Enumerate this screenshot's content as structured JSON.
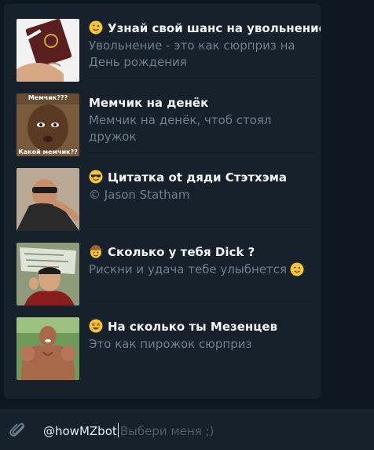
{
  "results": [
    {
      "title": "Узнай свой шанс на увольнение",
      "description": "Увольнение - это как сюрприз на День рождения",
      "emoji_icon": "winking-face-icon"
    },
    {
      "title": "Мемчик на денёк",
      "description": "Мемчик на денёк, чтоб стоял дружок",
      "thumb_caption_top": "Мемчик???",
      "thumb_caption_bottom": "Какой мемчик??"
    },
    {
      "title": "Цитатка ot дяди Стэтхэма",
      "description": "© Jason Statham",
      "emoji_icon": "sunglasses-face-icon"
    },
    {
      "title": "Сколько у тебя Dick ?",
      "description": "Рискни и удача тебе улыбнется",
      "emoji_icon": "cowboy-face-icon",
      "description_emoji_icon": "winking-face-icon"
    },
    {
      "title": "На сколько ты Мезенцев",
      "description": "Это как пирожок сюрприз",
      "emoji_icon": "star-struck-face-icon"
    }
  ],
  "composer": {
    "bot_username": "@howMZbot",
    "placeholder": "Выбери меня ;)",
    "attach_icon": "paperclip-icon"
  },
  "colors": {
    "background": "#0e1621",
    "panel": "#17212b",
    "title_text": "#f5f5f5",
    "description_text": "#6d7f8f",
    "placeholder_text": "#4e5c69"
  }
}
